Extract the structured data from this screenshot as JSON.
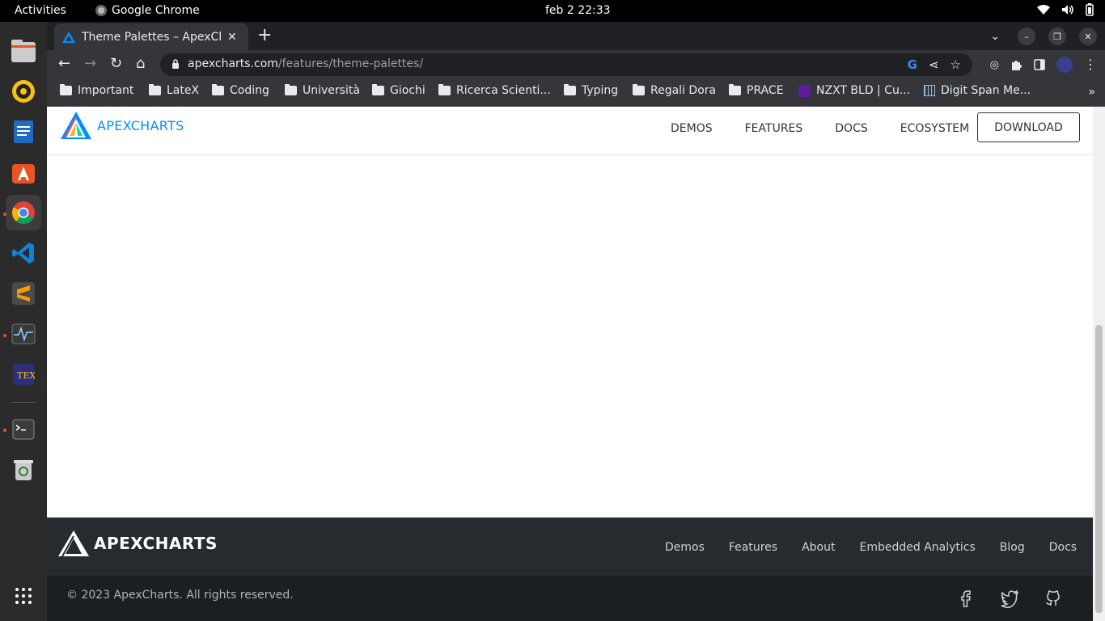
{
  "topbar": {
    "activities": "Activities",
    "app_name": "Google Chrome",
    "clock": "feb 2  22:33"
  },
  "browser": {
    "tab_title": "Theme Palettes – ApexCharts",
    "url_domain": "apexcharts.com",
    "url_path": "/features/theme-palettes/",
    "bookmarks": [
      "Important",
      "LateX",
      "Coding",
      "Università",
      "Giochi",
      "Ricerca Scienti...",
      "Typing",
      "Regali Dora",
      "PRACE",
      "NZXT BLD | Cu...",
      "Digit Span Me..."
    ]
  },
  "site": {
    "logo_text": "APEXCHARTS",
    "nav": [
      "DEMOS",
      "FEATURES",
      "DOCS",
      "ECOSYSTEM"
    ],
    "download_label": "DOWNLOAD"
  },
  "footer": {
    "logo_text": "APEXCHARTS",
    "links": [
      "Demos",
      "Features",
      "About",
      "Embedded Analytics",
      "Blog",
      "Docs"
    ],
    "copyright": "© 2023 ApexCharts. All rights reserved."
  },
  "colors": {
    "brand": "#008ffb",
    "footer_dark": "#262b30",
    "footer_darker": "#1b1f22"
  }
}
